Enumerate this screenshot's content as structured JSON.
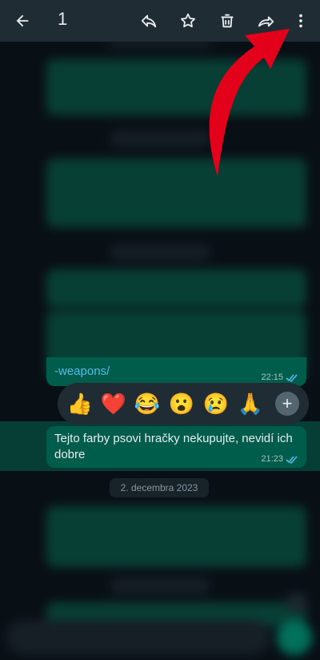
{
  "topbar": {
    "selected_count": "1",
    "icons": [
      "back-arrow-icon",
      "reply-icon",
      "star-icon",
      "delete-icon",
      "forward-icon",
      "more-vert-icon"
    ]
  },
  "selected_message": {
    "prev_text_tail": "-weapons/",
    "prev_time": "22:15",
    "text": "Tejto farby psovi hračky nekupujte, nevidí ich dobre",
    "time": "21:23"
  },
  "reactions": [
    "👍",
    "❤️",
    "😂",
    "😮",
    "😢",
    "🙏"
  ],
  "reaction_more_label": "+",
  "date_separator": "2. decembra 2023",
  "colors": {
    "accent": "#00a884",
    "outgoing_bubble": "#005c4b",
    "header": "#1f2c34",
    "annotation_arrow": "#e3001b"
  }
}
